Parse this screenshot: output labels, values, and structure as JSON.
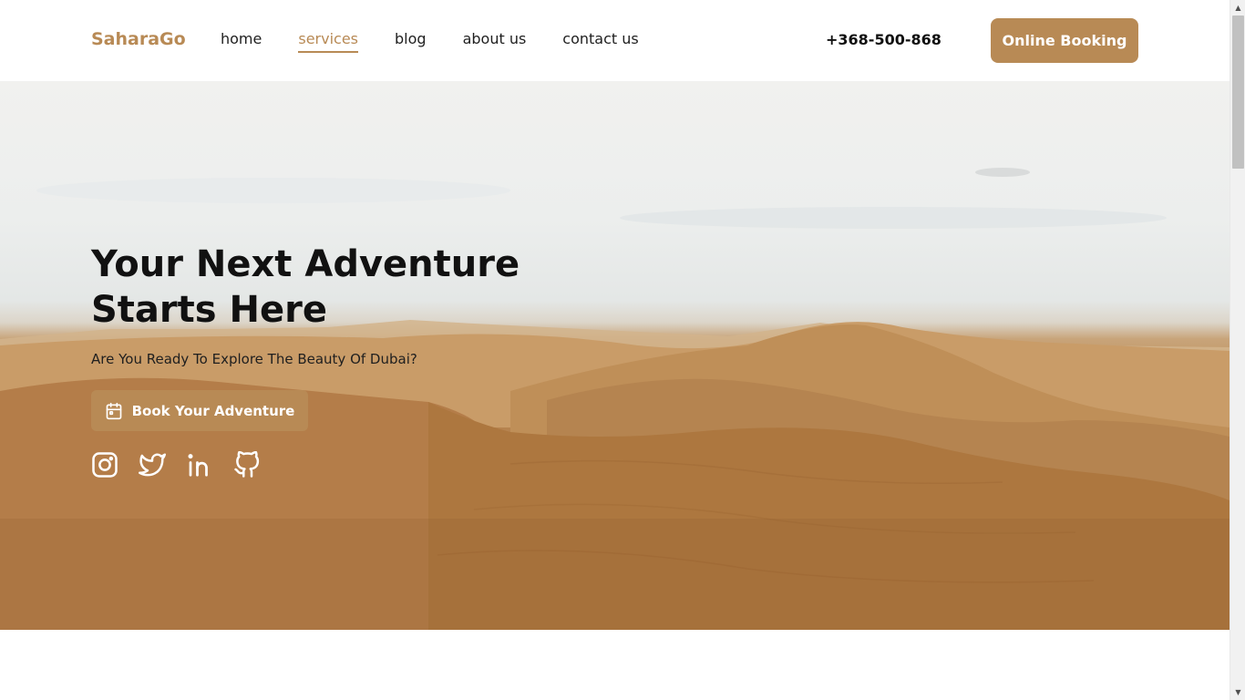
{
  "header": {
    "logo": "SaharaGo",
    "nav": [
      {
        "label": "home",
        "active": false
      },
      {
        "label": "services",
        "active": true
      },
      {
        "label": "blog",
        "active": false
      },
      {
        "label": "about us",
        "active": false
      },
      {
        "label": "contact us",
        "active": false
      }
    ],
    "phone": "+368-500-868",
    "booking_label": "Online Booking"
  },
  "hero": {
    "title_line1": "Your Next Adventure",
    "title_line2": "Starts Here",
    "subtitle": "Are You Ready To Explore The Beauty Of Dubai?",
    "button_label": "Book Your Adventure",
    "button_icon": "calendar-icon",
    "socials": [
      "instagram-icon",
      "twitter-icon",
      "linkedin-icon",
      "github-icon"
    ]
  },
  "colors": {
    "accent": "#b88a55",
    "text_dark": "#111111",
    "white": "#ffffff"
  }
}
